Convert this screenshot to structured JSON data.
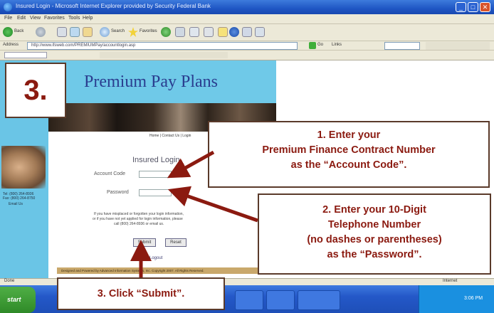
{
  "window": {
    "title": "Insured Login - Microsoft Internet Explorer provided by Security Federal Bank",
    "controls": [
      "_",
      "□",
      "✕"
    ]
  },
  "menu": [
    "File",
    "Edit",
    "View",
    "Favorites",
    "Tools",
    "Help"
  ],
  "toolbar": {
    "back_label": "Back",
    "search_label": "Search",
    "favorites_label": "Favorites"
  },
  "address": {
    "label": "Address",
    "url": "http://www.ifsweb.com/PREMIUMPay/accountlogin.asp",
    "go_label": "Go",
    "links_label": "Links"
  },
  "site": {
    "title": "Premium Pay Plans",
    "nav_text": "Home  |  Contact Us  |  Login",
    "left_phone_1": "Tel: (800) 264-8936",
    "left_phone_2": "Fax: (800) 264-8750",
    "left_email": "Email Us"
  },
  "login": {
    "title": "Insured Login",
    "account_label": "Account Code",
    "password_label": "Password",
    "info_1": "If you have misplaced or forgotten your login information,",
    "info_2": "or if you have not yet applied for login information, please",
    "info_3": "call (800) 264-8936 or email us.",
    "submit_label": "Submit",
    "reset_label": "Reset",
    "logout_label": "Logout",
    "footer": "Designed and Powered by Advanced Information Systems, Inc. Copyright 2007. All Rights Reserved."
  },
  "status": {
    "left": "Done",
    "zone": "Internet"
  },
  "taskbar": {
    "start_label": "start",
    "time": "3:06 PM"
  },
  "callouts": {
    "step_number": "3.",
    "c1_line1": "1.   Enter your",
    "c1_line2": "Premium Finance Contract Number",
    "c1_line3": "as the “Account Code”.",
    "c2_line1": "2.   Enter your 10-Digit",
    "c2_line2": "Telephone Number",
    "c2_line3": "(no dashes or parentheses)",
    "c2_line4": "as the “Password”.",
    "c3": "3.   Click “Submit”."
  },
  "colors": {
    "callout_text": "#8b1a10",
    "arrow": "#8b1a10",
    "header_bg": "#6fc9e8",
    "title_text": "#2a3d8f"
  }
}
